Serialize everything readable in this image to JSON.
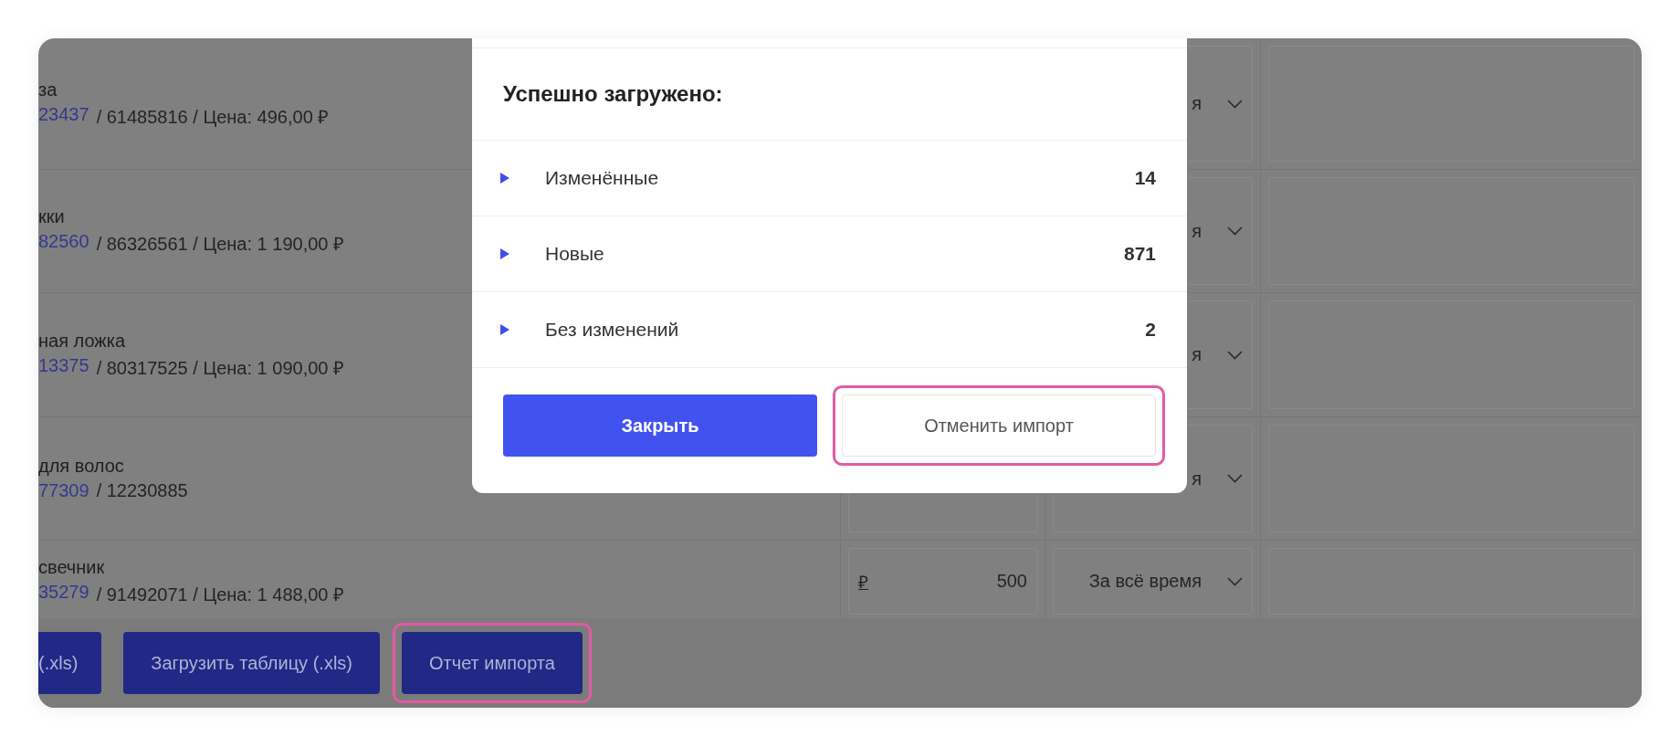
{
  "products": [
    {
      "name": "за",
      "article": "23437",
      "details": "/ 61485816 / Цена: 496,00 ₽",
      "period": "я"
    },
    {
      "name": "кки",
      "article": "82560",
      "details": "/ 86326561 / Цена: 1 190,00 ₽",
      "period": "я"
    },
    {
      "name": "ная ложка",
      "article": "13375",
      "details": "/ 80317525 / Цена: 1 090,00 ₽",
      "period": "я"
    },
    {
      "name": "для волос",
      "article": "77309",
      "details": "/ 12230885",
      "period": "я"
    },
    {
      "name": "свечник",
      "article": "35279",
      "details": "/ 91492071 / Цена: 1 488,00 ₽",
      "period": "За всё время",
      "price": {
        "currency": "₽",
        "value": "500"
      }
    }
  ],
  "bottom_bar": {
    "buttons": [
      {
        "label": "(.xls)",
        "highlighted": false
      },
      {
        "label": "Загрузить таблицу (.xls)",
        "highlighted": false
      },
      {
        "label": "Отчет импорта",
        "highlighted": true
      }
    ]
  },
  "modal": {
    "title": "Успешно загружено:",
    "groups": [
      {
        "label": "Изменённые",
        "count": "14",
        "expanded": false
      },
      {
        "label": "Новые",
        "count": "871",
        "expanded": false
      },
      {
        "label": "Без изменений",
        "count": "2",
        "expanded": false
      }
    ],
    "buttons": [
      {
        "label": "Закрыть",
        "kind": "primary",
        "highlighted": false
      },
      {
        "label": "Отменить импорт",
        "kind": "secondary",
        "highlighted": true
      }
    ]
  }
}
